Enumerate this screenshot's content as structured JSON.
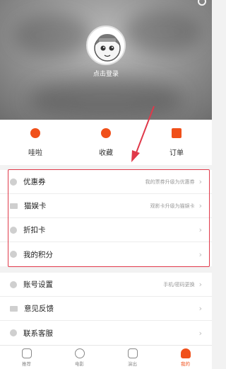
{
  "profile": {
    "login_text": "点击登录"
  },
  "quick_actions": [
    {
      "label": "哇啦",
      "icon": "chat-bubble-icon"
    },
    {
      "label": "收藏",
      "icon": "eye-icon"
    },
    {
      "label": "订单",
      "icon": "order-icon"
    }
  ],
  "group1": [
    {
      "label": "优惠券",
      "hint": "我的票券升级为优惠券",
      "icon": "tag-icon"
    },
    {
      "label": "猫娱卡",
      "hint": "观影卡升级为猫娱卡",
      "icon": "card-icon"
    },
    {
      "label": "折扣卡",
      "hint": "",
      "icon": "discount-icon"
    },
    {
      "label": "我的积分",
      "hint": "",
      "icon": "points-icon"
    }
  ],
  "group2": [
    {
      "label": "账号设置",
      "hint": "手机/密码更换",
      "icon": "location-icon"
    },
    {
      "label": "意见反馈",
      "hint": "",
      "icon": "feedback-icon"
    },
    {
      "label": "联系客服",
      "hint": "",
      "icon": "service-icon"
    }
  ],
  "tabbar": [
    {
      "label": "推荐",
      "icon": "recommend-icon",
      "active": false
    },
    {
      "label": "电影",
      "icon": "film-reel-icon",
      "active": false
    },
    {
      "label": "演出",
      "icon": "ticket-icon",
      "active": false
    },
    {
      "label": "我的",
      "icon": "user-icon",
      "active": true
    }
  ],
  "colors": {
    "accent": "#f0501a",
    "highlight": "#e0394a"
  }
}
